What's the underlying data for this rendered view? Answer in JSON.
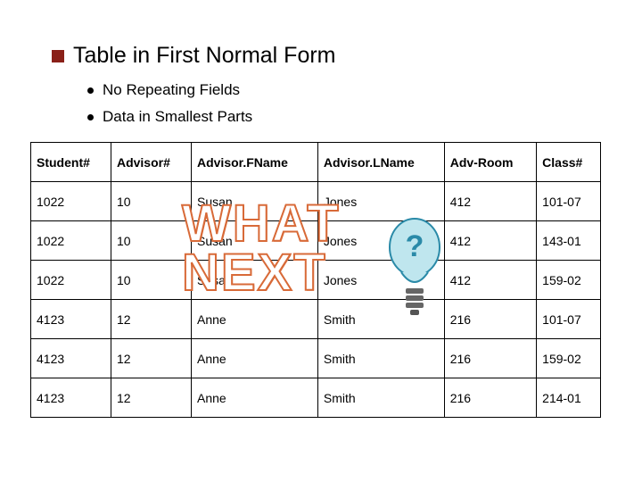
{
  "title": "Table in First Normal Form",
  "bullets": {
    "b1": "No Repeating Fields",
    "b2": "Data in Smallest Parts"
  },
  "headers": {
    "c0": "Student#",
    "c1": "Advisor#",
    "c2": "Advisor.FName",
    "c3": "Advisor.LName",
    "c4": "Adv-Room",
    "c5": "Class#"
  },
  "rows": {
    "r0": {
      "c0": "1022",
      "c1": "10",
      "c2": "Susan",
      "c3": "Jones",
      "c4": "412",
      "c5": "101-07"
    },
    "r1": {
      "c0": "1022",
      "c1": "10",
      "c2": "Susan",
      "c3": "Jones",
      "c4": "412",
      "c5": "143-01"
    },
    "r2": {
      "c0": "1022",
      "c1": "10",
      "c2": "Susan",
      "c3": "Jones",
      "c4": "412",
      "c5": "159-02"
    },
    "r3": {
      "c0": "4123",
      "c1": "12",
      "c2": "Anne",
      "c3": "Smith",
      "c4": "216",
      "c5": "101-07"
    },
    "r4": {
      "c0": "4123",
      "c1": "12",
      "c2": "Anne",
      "c3": "Smith",
      "c4": "216",
      "c5": "159-02"
    },
    "r5": {
      "c0": "4123",
      "c1": "12",
      "c2": "Anne",
      "c3": "Smith",
      "c4": "216",
      "c5": "214-01"
    }
  },
  "overlay": {
    "line1": "WHAT",
    "line2": "NEXT"
  }
}
